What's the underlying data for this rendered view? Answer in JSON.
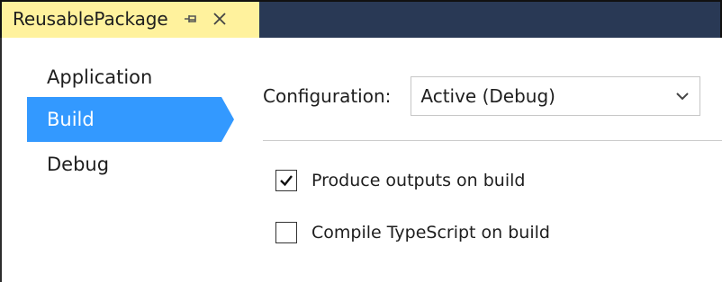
{
  "tab": {
    "title": "ReusablePackage",
    "pin_icon": "pin-icon",
    "close_icon": "close-icon"
  },
  "colors": {
    "tab_active_bg": "#fff29d",
    "tabstrip_bg": "#293955",
    "selected_nav_bg": "#3399ff",
    "text": "#1e1e1e"
  },
  "sidebar": {
    "items": [
      {
        "label": "Application",
        "selected": false
      },
      {
        "label": "Build",
        "selected": true
      },
      {
        "label": "Debug",
        "selected": false
      }
    ]
  },
  "config": {
    "label": "Configuration:",
    "selected_value": "Active (Debug)",
    "dropdown_icon": "chevron-down-icon"
  },
  "options": {
    "produce_outputs": {
      "label": "Produce outputs on build",
      "checked": true
    },
    "compile_typescript": {
      "label": "Compile TypeScript on build",
      "checked": false
    }
  }
}
